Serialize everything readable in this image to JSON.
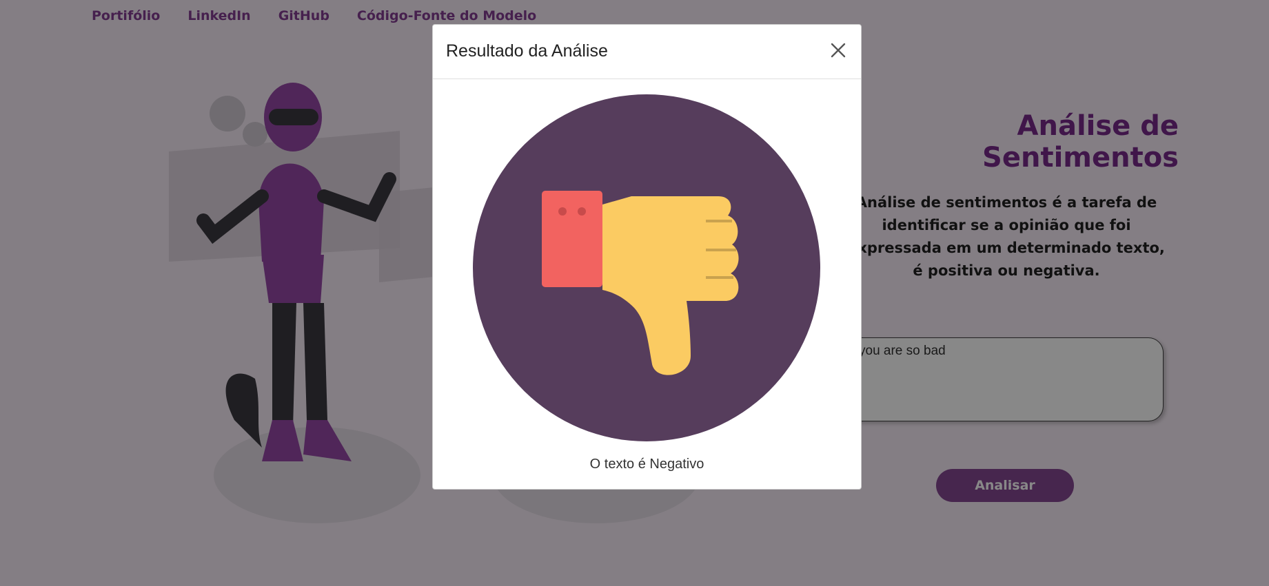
{
  "nav": {
    "portfolio": "Portifólio",
    "linkedin": "LinkedIn",
    "github": "GitHub",
    "source": "Código-Fonte do Modelo"
  },
  "hero": {
    "title": "Análise de Sentimentos",
    "description": "Análise de sentimentos é a tarefa de identificar se a opinião que foi expressada em um determinado texto, é positiva ou negativa."
  },
  "input": {
    "value": "you are so bad"
  },
  "analyze_button": "Analisar",
  "modal": {
    "title": "Resultado da Análise",
    "result": "O texto é Negativo",
    "icon": "thumbs-down-icon",
    "close_icon": "close-icon"
  },
  "colors": {
    "accent": "#7c3a8a",
    "circle": "#563d5c",
    "cuff": "#f26360",
    "thumb": "#fbcb62"
  }
}
